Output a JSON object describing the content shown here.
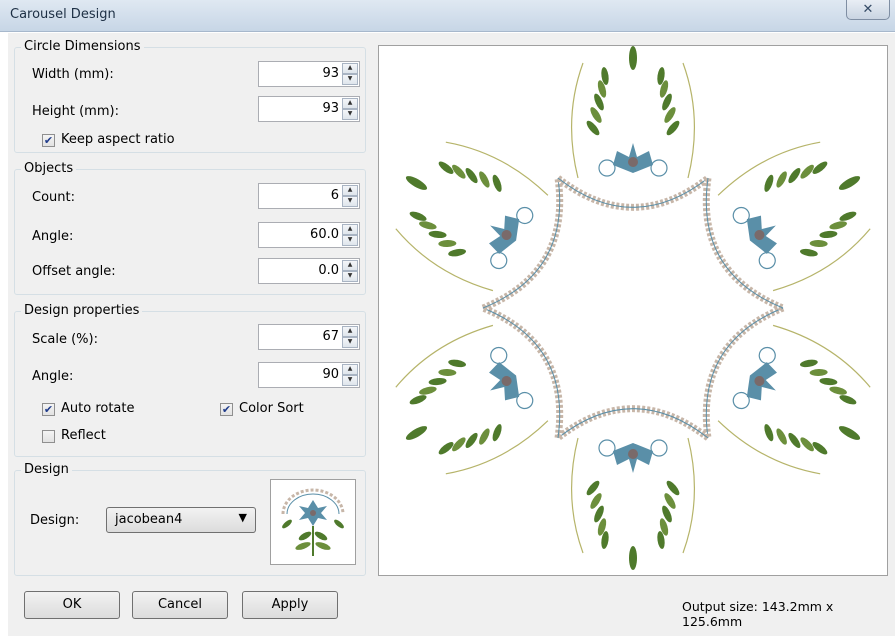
{
  "window": {
    "title": "Carousel Design"
  },
  "circle_dimensions": {
    "title": "Circle Dimensions",
    "width_label": "Width (mm):",
    "width_value": "93",
    "height_label": "Height (mm):",
    "height_value": "93",
    "keep_aspect_label": "Keep aspect ratio",
    "keep_aspect_checked": true
  },
  "objects": {
    "title": "Objects",
    "count_label": "Count:",
    "count_value": "6",
    "angle_label": "Angle:",
    "angle_value": "60.0",
    "offset_label": "Offset angle:",
    "offset_value": "0.0"
  },
  "design_properties": {
    "title": "Design properties",
    "scale_label": "Scale (%):",
    "scale_value": "67",
    "angle_label": "Angle:",
    "angle_value": "90",
    "auto_rotate_label": "Auto rotate",
    "auto_rotate_checked": true,
    "color_sort_label": "Color Sort",
    "color_sort_checked": true,
    "reflect_label": "Reflect",
    "reflect_checked": false
  },
  "design": {
    "title": "Design",
    "design_label": "Design:",
    "selected": "jacobean4"
  },
  "buttons": {
    "ok": "OK",
    "cancel": "Cancel",
    "apply": "Apply"
  },
  "output_size": "Output size: 143.2mm x 125.6mm",
  "icons": {
    "close": "close-icon",
    "spin_up": "arrow-up-icon",
    "spin_down": "arrow-down-icon",
    "dropdown": "chevron-down-icon"
  },
  "colors": {
    "leaf_green": "#4f7a2c",
    "ornament_blue": "#5a8fa8",
    "stitch_tan": "#c7b6a8",
    "accent": "#1f3b8a"
  }
}
